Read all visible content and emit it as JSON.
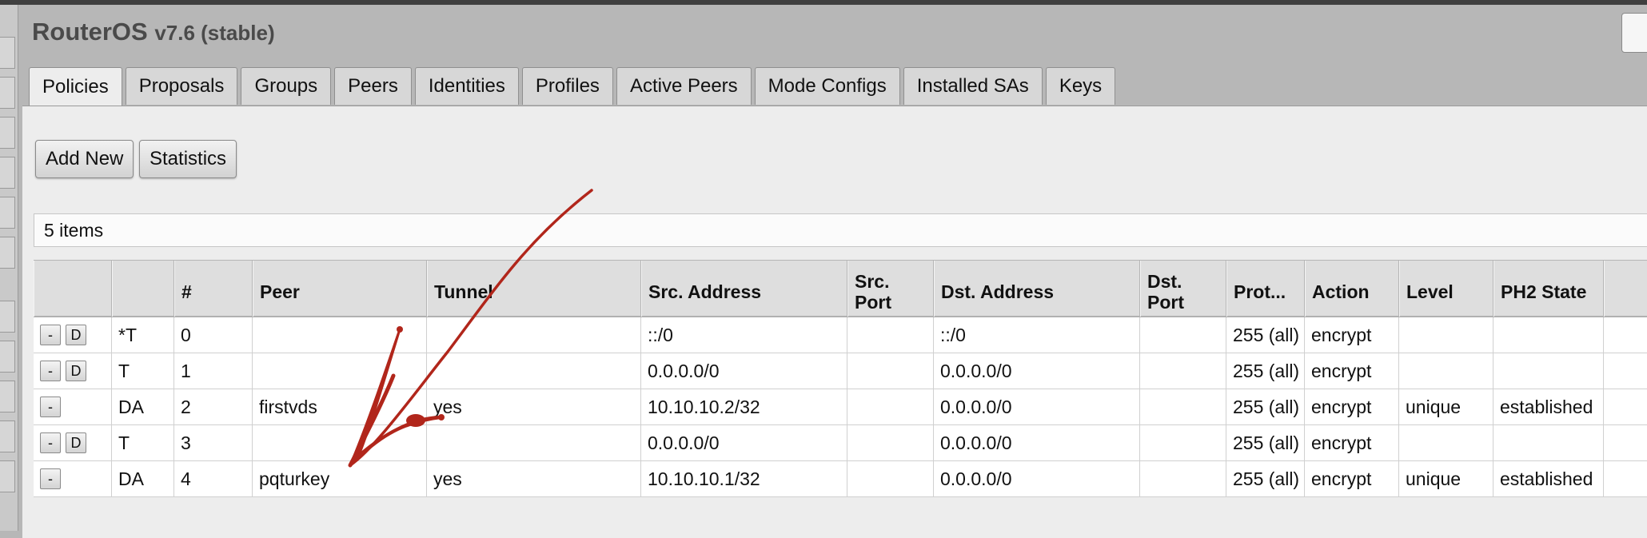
{
  "app": {
    "title": "RouterOS",
    "version": "v7.6 (stable)"
  },
  "tabs": [
    {
      "label": "Policies",
      "active": true
    },
    {
      "label": "Proposals"
    },
    {
      "label": "Groups"
    },
    {
      "label": "Peers"
    },
    {
      "label": "Identities"
    },
    {
      "label": "Profiles"
    },
    {
      "label": "Active Peers"
    },
    {
      "label": "Mode Configs"
    },
    {
      "label": "Installed SAs"
    },
    {
      "label": "Keys"
    }
  ],
  "toolbar": {
    "add_new_label": "Add New",
    "statistics_label": "Statistics"
  },
  "item_count": "5 items",
  "table": {
    "columns": [
      "",
      "",
      "#",
      "Peer",
      "Tunnel",
      "Src. Address",
      "Src. Port",
      "Dst. Address",
      "Dst. Port",
      "Prot...",
      "Action",
      "Level",
      "PH2 State"
    ],
    "row_buttons": {
      "remove": "-",
      "disable": "D"
    },
    "rows": [
      {
        "flags": "*T",
        "num": "0",
        "peer": "",
        "tunnel": "",
        "src_address": "::/0",
        "src_port": "",
        "dst_address": "::/0",
        "dst_port": "",
        "protocol": "255 (all)",
        "action": "encrypt",
        "level": "",
        "ph2_state": "",
        "has_disable": true
      },
      {
        "flags": "T",
        "num": "1",
        "peer": "",
        "tunnel": "",
        "src_address": "0.0.0.0/0",
        "src_port": "",
        "dst_address": "0.0.0.0/0",
        "dst_port": "",
        "protocol": "255 (all)",
        "action": "encrypt",
        "level": "",
        "ph2_state": "",
        "has_disable": true
      },
      {
        "flags": "DA",
        "num": "2",
        "peer": "firstvds",
        "tunnel": "yes",
        "src_address": "10.10.10.2/32",
        "src_port": "",
        "dst_address": "0.0.0.0/0",
        "dst_port": "",
        "protocol": "255 (all)",
        "action": "encrypt",
        "level": "unique",
        "ph2_state": "established",
        "has_disable": false
      },
      {
        "flags": "T",
        "num": "3",
        "peer": "",
        "tunnel": "",
        "src_address": "0.0.0.0/0",
        "src_port": "",
        "dst_address": "0.0.0.0/0",
        "dst_port": "",
        "protocol": "255 (all)",
        "action": "encrypt",
        "level": "",
        "ph2_state": "",
        "has_disable": true
      },
      {
        "flags": "DA",
        "num": "4",
        "peer": "pqturkey",
        "tunnel": "yes",
        "src_address": "10.10.10.1/32",
        "src_port": "",
        "dst_address": "0.0.0.0/0",
        "dst_port": "",
        "protocol": "255 (all)",
        "action": "encrypt",
        "level": "unique",
        "ph2_state": "established",
        "has_disable": false
      }
    ]
  },
  "colors": {
    "annotation": "#b1261b",
    "background": "#b7b7b7",
    "panel": "#ededed"
  }
}
